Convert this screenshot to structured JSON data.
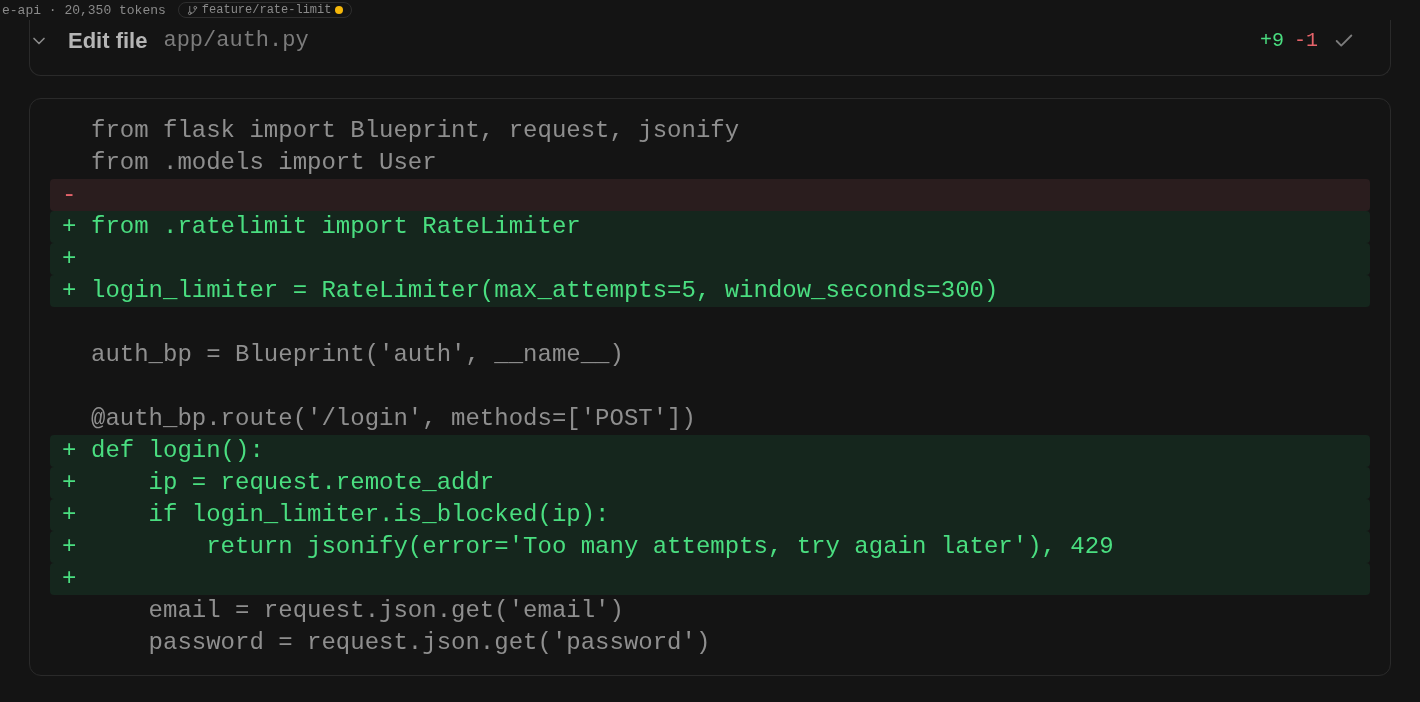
{
  "top_bar": {
    "project": "e-api · 20,350 tokens",
    "branch": "feature/rate-limit",
    "branch_dirty": true
  },
  "tool_call": {
    "expanded": true,
    "action": "Edit file",
    "path": "app/auth.py",
    "added": "+9",
    "removed": "-1",
    "done": true
  },
  "diff": [
    {
      "kind": "context",
      "text": "from flask import Blueprint, request, jsonify"
    },
    {
      "kind": "context",
      "text": "from .models import User"
    },
    {
      "kind": "remove",
      "sign": "-"
    },
    {
      "kind": "add",
      "sign": "+",
      "text": "from .ratelimit import RateLimiter"
    },
    {
      "kind": "add",
      "sign": "+"
    },
    {
      "kind": "add",
      "sign": "+",
      "text": "login_limiter = RateLimiter(max_attempts=5, window_seconds=300)"
    },
    {
      "kind": "blank"
    },
    {
      "kind": "context",
      "text": "auth_bp = Blueprint('auth', __name__)"
    },
    {
      "kind": "blank"
    },
    {
      "kind": "context",
      "text": "@auth_bp.route('/login', methods=['POST'])"
    },
    {
      "kind": "add",
      "sign": "+",
      "text": "def login():"
    },
    {
      "kind": "add",
      "sign": "+",
      "text": "    ip = request.remote_addr"
    },
    {
      "kind": "add",
      "sign": "+",
      "text": "    if login_limiter.is_blocked(ip):"
    },
    {
      "kind": "add",
      "sign": "+",
      "text": "        return jsonify(error='Too many attempts, try again later'), 429"
    },
    {
      "kind": "add",
      "sign": "+"
    },
    {
      "kind": "context",
      "text": "    email = request.json.get('email')"
    },
    {
      "kind": "context",
      "text": "    password = request.json.get('password')"
    }
  ]
}
